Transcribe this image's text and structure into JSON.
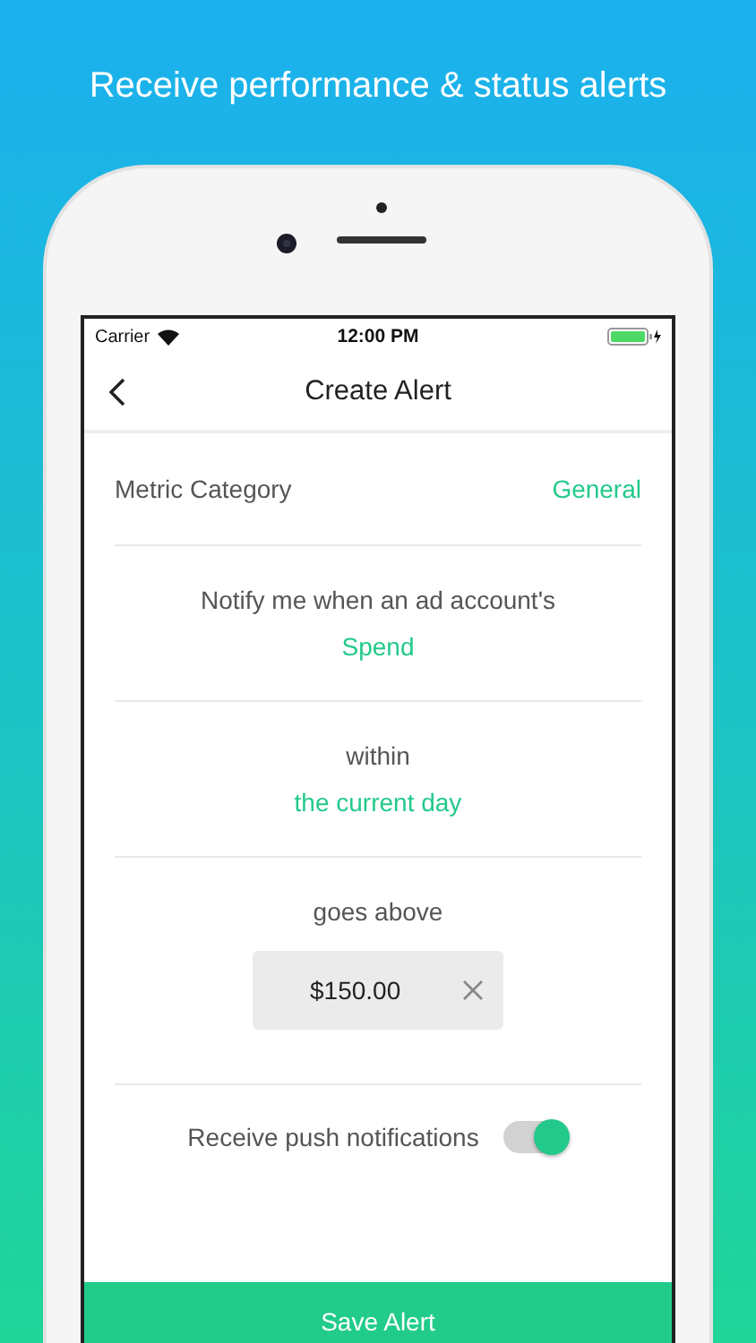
{
  "headline": "Receive performance & status alerts",
  "status_bar": {
    "carrier": "Carrier",
    "time": "12:00 PM"
  },
  "nav": {
    "title": "Create Alert"
  },
  "metric_category": {
    "label": "Metric Category",
    "value": "General"
  },
  "conditions": [
    {
      "prompt": "Notify me when an ad account's",
      "value": "Spend"
    },
    {
      "prompt": "within",
      "value": "the current day"
    }
  ],
  "threshold": {
    "prompt": "goes above",
    "value": "$150.00"
  },
  "push_notifications": {
    "label": "Receive push notifications",
    "on": true
  },
  "save_button": "Save Alert"
}
